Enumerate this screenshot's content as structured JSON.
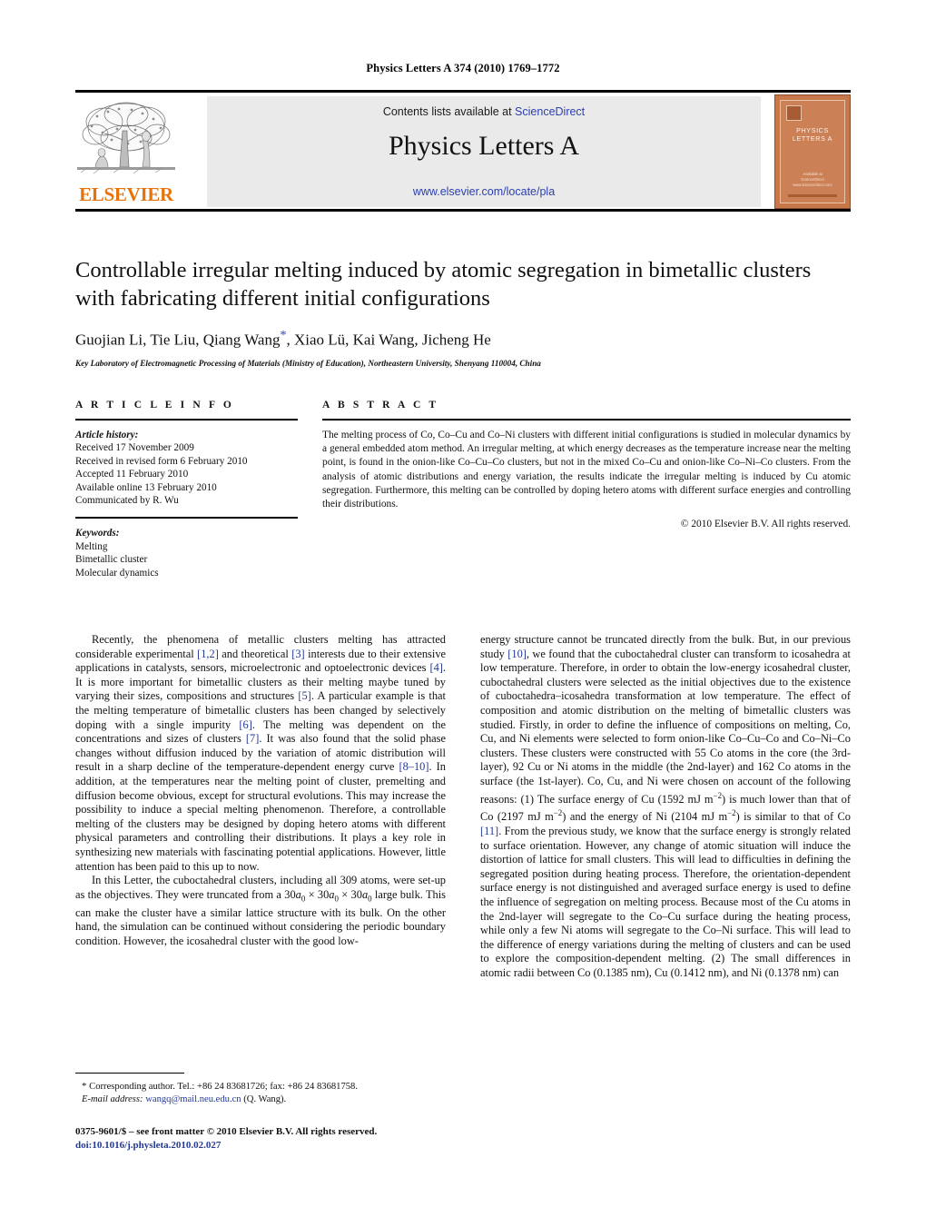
{
  "running_head": "Physics Letters A 374 (2010) 1769–1772",
  "banner": {
    "publisher_name": "ELSEVIER",
    "contents_prefix": "Contents lists available at ",
    "sciencedirect": "ScienceDirect",
    "journal_title": "Physics Letters A",
    "journal_url": "www.elsevier.com/locate/pla",
    "cover": {
      "title": "PHYSICS LETTERS A",
      "foot_line1": "Available at",
      "foot_line2": "ScienceDirect",
      "foot_line3": "www.sciencedirect.com"
    }
  },
  "article": {
    "title": "Controllable irregular melting induced by atomic segregation in bimetallic clusters with fabricating different initial configurations",
    "authors": "Guojian Li, Tie Liu, Qiang Wang",
    "corresponding_marker": "*",
    "authors_rest": ", Xiao Lü, Kai Wang, Jicheng He",
    "affiliation": "Key Laboratory of Electromagnetic Processing of Materials (Ministry of Education), Northeastern University, Shenyang 110004, China"
  },
  "info": {
    "heading": "A R T I C L E   I N F O",
    "history_label": "Article history:",
    "history": [
      "Received 17 November 2009",
      "Received in revised form 6 February 2010",
      "Accepted 11 February 2010",
      "Available online 13 February 2010",
      "Communicated by R. Wu"
    ],
    "keywords_label": "Keywords:",
    "keywords": [
      "Melting",
      "Bimetallic cluster",
      "Molecular dynamics"
    ]
  },
  "abstract": {
    "heading": "A B S T R A C T",
    "text": "The melting process of Co, Co–Cu and Co–Ni clusters with different initial configurations is studied in molecular dynamics by a general embedded atom method. An irregular melting, at which energy decreases as the temperature increase near the melting point, is found in the onion-like Co–Cu–Co clusters, but not in the mixed Co–Cu and onion-like Co–Ni–Co clusters. From the analysis of atomic distributions and energy variation, the results indicate the irregular melting is induced by Cu atomic segregation. Furthermore, this melting can be controlled by doping hetero atoms with different surface energies and controlling their distributions.",
    "copyright": "© 2010 Elsevier B.V. All rights reserved."
  },
  "body": {
    "left_paragraph_1_a": "Recently, the phenomena of metallic clusters melting has attracted considerable experimental ",
    "ref_1_2": "[1,2]",
    "left_paragraph_1_b": " and theoretical ",
    "ref_3": "[3]",
    "left_paragraph_1_c": " interests due to their extensive applications in catalysts, sensors, microelectronic and optoelectronic devices ",
    "ref_4": "[4]",
    "left_paragraph_1_d": ". It is more important for bimetallic clusters as their melting maybe tuned by varying their sizes, compositions and structures ",
    "ref_5": "[5]",
    "left_paragraph_1_e": ". A particular example is that the melting temperature of bimetallic clusters has been changed by selectively doping with a single impurity ",
    "ref_6": "[6]",
    "left_paragraph_1_f": ". The melting was dependent on the concentrations and sizes of clusters ",
    "ref_7": "[7]",
    "left_paragraph_1_g": ". It was also found that the solid phase changes without diffusion induced by the variation of atomic distribution will result in a sharp decline of the temperature-dependent energy curve ",
    "ref_8_10": "[8–10]",
    "left_paragraph_1_h": ". In addition, at the temperatures near the melting point of cluster, premelting and diffusion become obvious, except for structural evolutions. This may increase the possibility to induce a special melting phenomenon. Therefore, a controllable melting of the clusters may be designed by doping hetero atoms with different physical parameters and controlling their distributions. It plays a key role in synthesizing new materials with fascinating potential applications. However, little attention has been paid to this up to now.",
    "left_paragraph_2_a": "In this Letter, the cuboctahedral clusters, including all 309 atoms, were set-up as the objectives. They were truncated from a 30",
    "a0": "a",
    "a0_sub": "0",
    "left_paragraph_2_b": " large bulk. This can make the cluster have a similar lattice structure with its bulk. On the other hand, the simulation can be continued without considering the periodic boundary condition. However, the icosahedral cluster with the good low-",
    "right_paragraph_1_a": "energy structure cannot be truncated directly from the bulk. But, in our previous study ",
    "ref_10": "[10]",
    "right_paragraph_1_b": ", we found that the cuboctahedral cluster can transform to icosahedra at low temperature. Therefore, in order to obtain the low-energy icosahedral cluster, cuboctahedral clusters were selected as the initial objectives due to the existence of cuboctahedra–icosahedra transformation at low temperature. The effect of composition and atomic distribution on the melting of bimetallic clusters was studied. Firstly, in order to define the influence of compositions on melting, Co, Cu, and Ni elements were selected to form onion-like Co–Cu–Co and Co–Ni–Co clusters. These clusters were constructed with 55 Co atoms in the core (the 3rd-layer), 92 Cu or Ni atoms in the middle (the 2nd-layer) and 162 Co atoms in the surface (the 1st-layer). Co, Cu, and Ni were chosen on account of the following reasons: (1) The surface energy of Cu (1592 mJ m",
    "sup_minus2": "−2",
    "right_paragraph_1_c": ") is much lower than that of Co (2197 mJ m",
    "right_paragraph_1_d": ") and the energy of Ni (2104 mJ m",
    "right_paragraph_1_e": ") is similar to that of Co ",
    "ref_11": "[11]",
    "right_paragraph_1_f": ". From the previous study, we know that the surface energy is strongly related to surface orientation. However, any change of atomic situation will induce the distortion of lattice for small clusters. This will lead to difficulties in defining the segregated position during heating process. Therefore, the orientation-dependent surface energy is not distinguished and averaged surface energy is used to define the influence of segregation on melting process. Because most of the Cu atoms in the 2nd-layer will segregate to the Co–Cu surface during the heating process, while only a few Ni atoms will segregate to the Co–Ni surface. This will lead to the difference of energy variations during the melting of clusters and can be used to explore the composition-dependent melting. (2) The small differences in atomic radii between Co (0.1385 nm), Cu (0.1412 nm), and Ni (0.1378 nm) can"
  },
  "footnotes": {
    "corresponding": "Corresponding author. Tel.: +86 24 83681726; fax: +86 24 83681758.",
    "email_label": "E-mail address:",
    "email": "wangq@mail.neu.edu.cn",
    "email_suffix": "(Q. Wang).",
    "imprint": "0375-9601/$ – see front matter  © 2010 Elsevier B.V. All rights reserved.",
    "doi": "doi:10.1016/j.physleta.2010.02.027"
  },
  "colors": {
    "link": "#2b3fb0",
    "reference": "#243a96",
    "elsevier_orange": "#e8730a",
    "cover_tan": "#c8774a",
    "banner_gray": "#eaeaea"
  }
}
